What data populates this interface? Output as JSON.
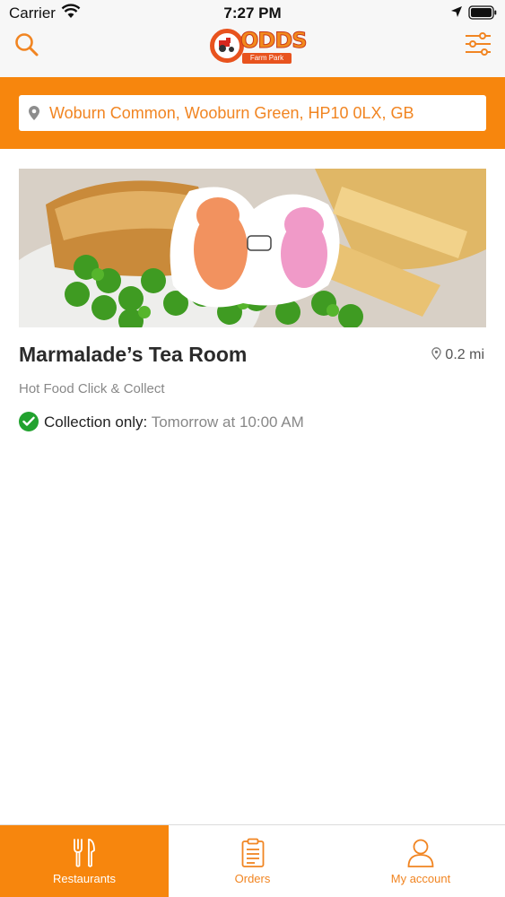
{
  "status_bar": {
    "carrier": "Carrier",
    "time": "7:27 PM"
  },
  "header": {
    "logo_text": "ODDS",
    "logo_subtext": "Farm Park",
    "search_icon": "search-icon",
    "filter_icon": "sliders-icon"
  },
  "location": {
    "address": "Woburn Common, Wooburn Green, HP10 0LX, GB",
    "icon": "map-pin-icon"
  },
  "restaurants": [
    {
      "name": "Marmalade’s Tea Room",
      "distance": "0.2 mi",
      "description": "Hot Food Click & Collect",
      "collection_label": "Collection only:",
      "collection_time": "Tomorrow at 10:00 AM"
    }
  ],
  "tabs": [
    {
      "label": "Restaurants",
      "icon": "fork-knife-icon",
      "active": true
    },
    {
      "label": "Orders",
      "icon": "clipboard-icon",
      "active": false
    },
    {
      "label": "My account",
      "icon": "user-icon",
      "active": false
    }
  ],
  "colors": {
    "accent": "#f7860d",
    "success": "#22a22f",
    "header_bg": "#f7f7f7"
  }
}
